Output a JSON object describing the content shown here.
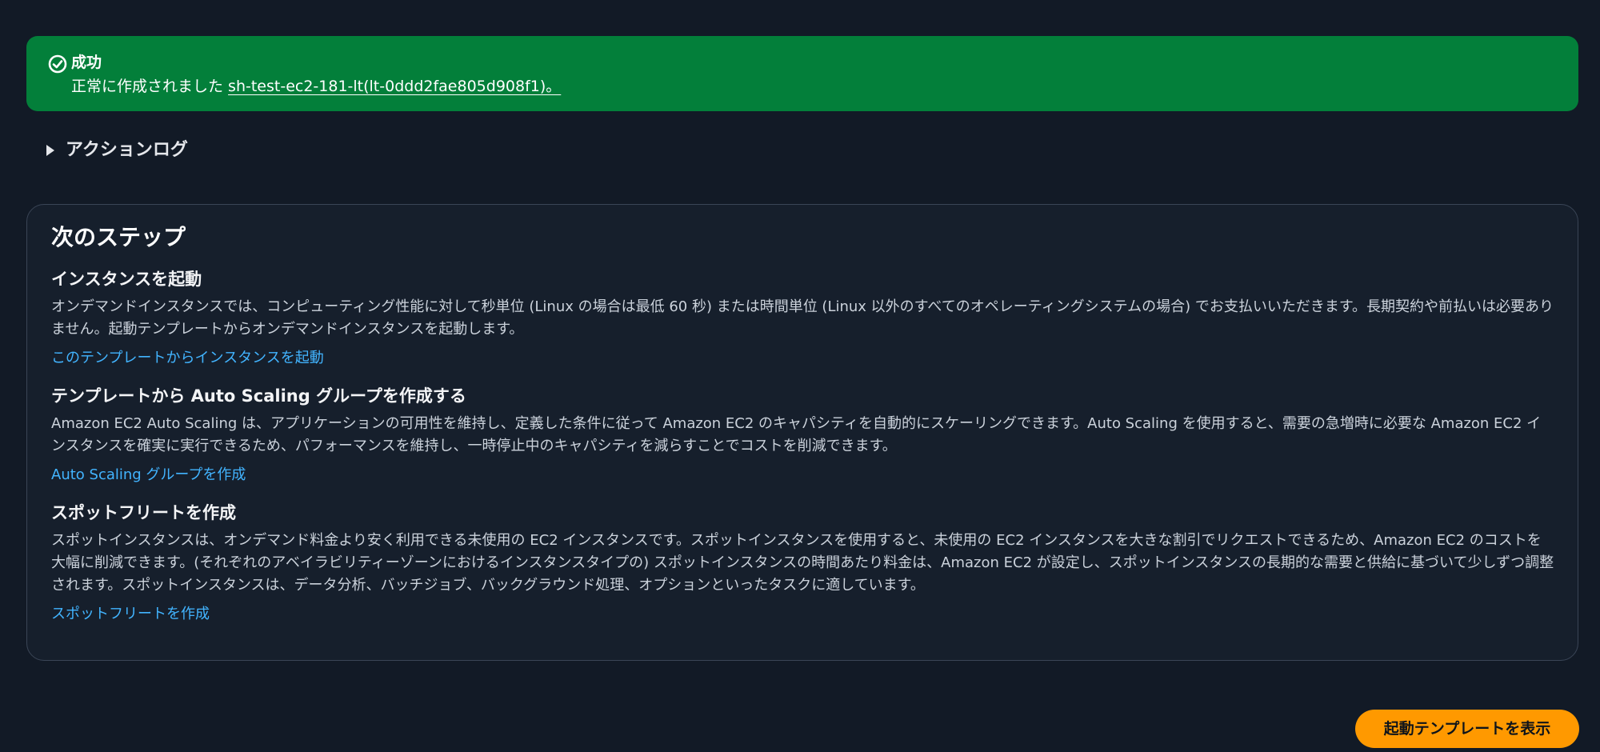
{
  "flash": {
    "icon": "check-circle-icon",
    "title": "成功",
    "message_prefix": "正常に作成されました ",
    "message_link": "sh-test-ec2-181-lt(lt-0ddd2fae805d908f1)。",
    "color": "#037f3a"
  },
  "action_log": {
    "label": "アクションログ",
    "icon": "caret-right-icon"
  },
  "next_steps": {
    "title": "次のステップ",
    "sections": [
      {
        "heading": "インスタンスを起動",
        "body": "オンデマンドインスタンスでは、コンピューティング性能に対して秒単位 (Linux の場合は最低 60 秒) または時間単位 (Linux 以外のすべてのオペレーティングシステムの場合) でお支払いいただきます。長期契約や前払いは必要ありません。起動テンプレートからオンデマンドインスタンスを起動します。",
        "link": "このテンプレートからインスタンスを起動"
      },
      {
        "heading": "テンプレートから Auto Scaling グループを作成する",
        "body": "Amazon EC2 Auto Scaling は、アプリケーションの可用性を維持し、定義した条件に従って Amazon EC2 のキャパシティを自動的にスケーリングできます。Auto Scaling を使用すると、需要の急増時に必要な Amazon EC2 インスタンスを確実に実行できるため、パフォーマンスを維持し、一時停止中のキャパシティを減らすことでコストを削減できます。",
        "link": "Auto Scaling グループを作成"
      },
      {
        "heading": "スポットフリートを作成",
        "body": "スポットインスタンスは、オンデマンド料金より安く利用できる未使用の EC2 インスタンスです。スポットインスタンスを使用すると、未使用の EC2 インスタンスを大きな割引でリクエストできるため、Amazon EC2 のコストを大幅に削減できます。(それぞれのアベイラビリティーゾーンにおけるインスタンスタイプの) スポットインスタンスの時間あたり料金は、Amazon EC2 が設定し、スポットインスタンスの長期的な需要と供給に基づいて少しずつ調整されます。スポットインスタンスは、データ分析、バッチジョブ、バックグラウンド処理、オプションといったタスクに適しています。",
        "link": "スポットフリートを作成"
      }
    ]
  },
  "footer": {
    "primary_button": "起動テンプレートを表示",
    "primary_color": "#ff9900"
  },
  "colors": {
    "background": "#121a26",
    "link": "#42b4ff",
    "card_border": "#3a4556"
  }
}
